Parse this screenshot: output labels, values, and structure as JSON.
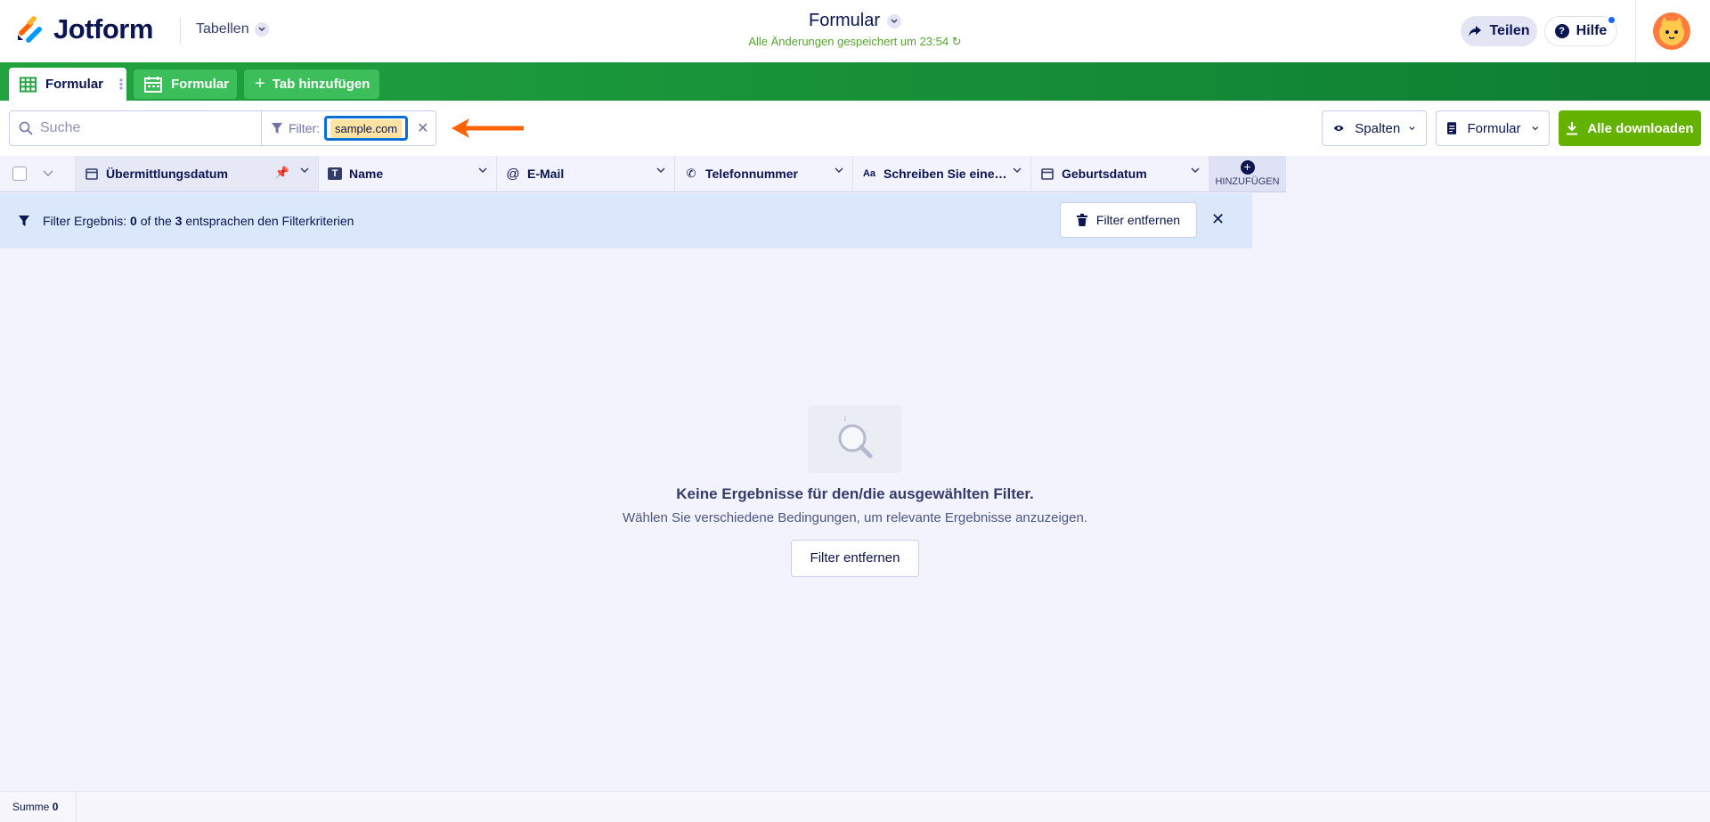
{
  "header": {
    "brand": "Jotform",
    "tables_menu": "Tabellen",
    "title": "Formular",
    "saved_status": "Alle Änderungen gespeichert um 23:54",
    "share_label": "Teilen",
    "help_label": "Hilfe"
  },
  "tabs": [
    {
      "label": "Formular"
    },
    {
      "label": "Formular"
    },
    {
      "label": "Tab hinzufügen"
    }
  ],
  "toolbar": {
    "search_placeholder": "Suche",
    "filter_label": "Filter:",
    "filter_value": "sample.com",
    "columns_label": "Spalten",
    "form_label": "Formular",
    "download_label": "Alle downloaden"
  },
  "columns": [
    {
      "label": "Übermittlungsdatum",
      "icon": "calendar-icon"
    },
    {
      "label": "Name",
      "icon": "text-icon"
    },
    {
      "label": "E-Mail",
      "icon": "at-icon"
    },
    {
      "label": "Telefonnummer",
      "icon": "phone-icon"
    },
    {
      "label": "Schreiben Sie eine…",
      "icon": "text-aa-icon"
    },
    {
      "label": "Geburtsdatum",
      "icon": "calendar-icon"
    }
  ],
  "add_column_label": "HINZUFÜGEN",
  "filter_result": {
    "prefix": "Filter Ergebnis:",
    "matched": "0",
    "of_the": "of the",
    "total": "3",
    "suffix": "entsprachen den Filterkriterien",
    "remove_label": "Filter entfernen"
  },
  "empty_state": {
    "title": "Keine Ergebnisse für den/die ausgewählten Filter.",
    "subtitle": "Wählen Sie verschiedene Bedingungen, um relevante Ergebnisse anzuzeigen.",
    "button_label": "Filter entfernen"
  },
  "footer": {
    "sum_label": "Summe",
    "sum_value": "0"
  },
  "colors": {
    "brand_green": "#0e7e32",
    "download_green": "#64b200",
    "filter_bar": "#dbe8fb",
    "arrow": "#ff6100"
  }
}
